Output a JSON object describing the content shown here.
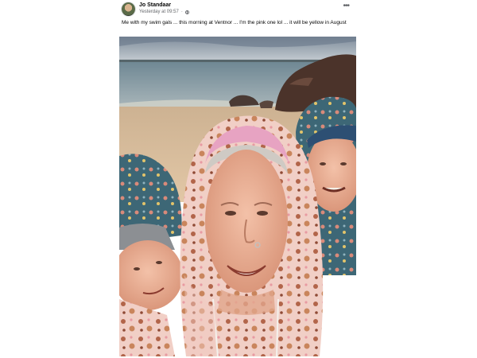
{
  "post": {
    "author": "Jo Standaar",
    "timestamp": "Yesterday at 09:57",
    "audience_icon": "globe-icon",
    "more_icon": "more-options-icon",
    "caption": "Me with my swim gals ... this morning at Ventnor ... I'm the pink one lol ... it will be yellow in August"
  },
  "photo": {
    "subject": "selfie-photo",
    "colors": {
      "sky": "#9aa7b4",
      "sea": "#7f949f",
      "sand": "#d9bfa0",
      "rock": "#4a342c",
      "pink_robe": "#efc7c0",
      "teal_towel": "#3f6b7c"
    }
  }
}
